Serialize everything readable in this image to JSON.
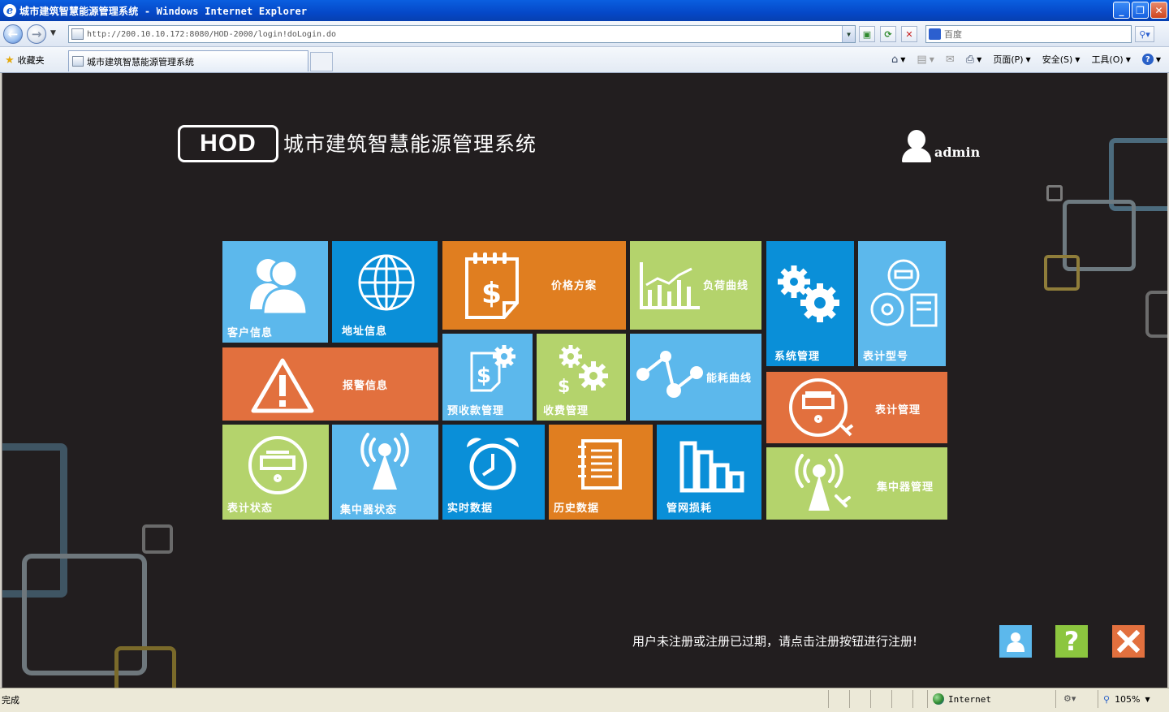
{
  "window": {
    "title": "城市建筑智慧能源管理系统 - Windows Internet Explorer",
    "minimize": "_",
    "restore": "❐",
    "close": "✕"
  },
  "browser": {
    "address": "http://200.10.10.172:8080/HOD-2000/login!doLogin.do",
    "search_placeholder": "百度",
    "favorites_label": "收藏夹",
    "tab_title": "城市建筑智慧能源管理系统",
    "commands": {
      "home_icon": "home-icon",
      "page": "页面(P)",
      "safety": "安全(S)",
      "tools": "工具(O)"
    },
    "status_text": "完成",
    "zone": "Internet",
    "zoom": "105%"
  },
  "header": {
    "logo_text": "HOD",
    "system_title": "城市建筑智慧能源管理系统",
    "username": "admin"
  },
  "tiles": {
    "customer_info": "客户信息",
    "address_info": "地址信息",
    "price_plan": "价格方案",
    "load_curve": "负荷曲线",
    "system_mgmt": "系统管理",
    "meter_model": "表计型号",
    "alarm_info": "报警信息",
    "prepay_mgmt": "预收款管理",
    "charge_mgmt": "收费管理",
    "energy_curve": "能耗曲线",
    "meter_mgmt": "表计管理",
    "meter_status": "表计状态",
    "concentrator_status": "集中器状态",
    "realtime_data": "实时数据",
    "history_data": "历史数据",
    "network_loss": "管网损耗",
    "concentrator_mgmt": "集中器管理"
  },
  "footer": {
    "notice": "用户未注册或注册已过期，请点击注册按钮进行注册!",
    "register_icon": "user-icon",
    "help_label": "?",
    "close_icon": "close-icon"
  },
  "colors": {
    "background": "#221e1f",
    "tile_sky": "#5cb8ec",
    "tile_blue": "#0a8fd8",
    "tile_orange": "#e07e20",
    "tile_red": "#e2703e",
    "tile_green": "#b4d36c"
  }
}
